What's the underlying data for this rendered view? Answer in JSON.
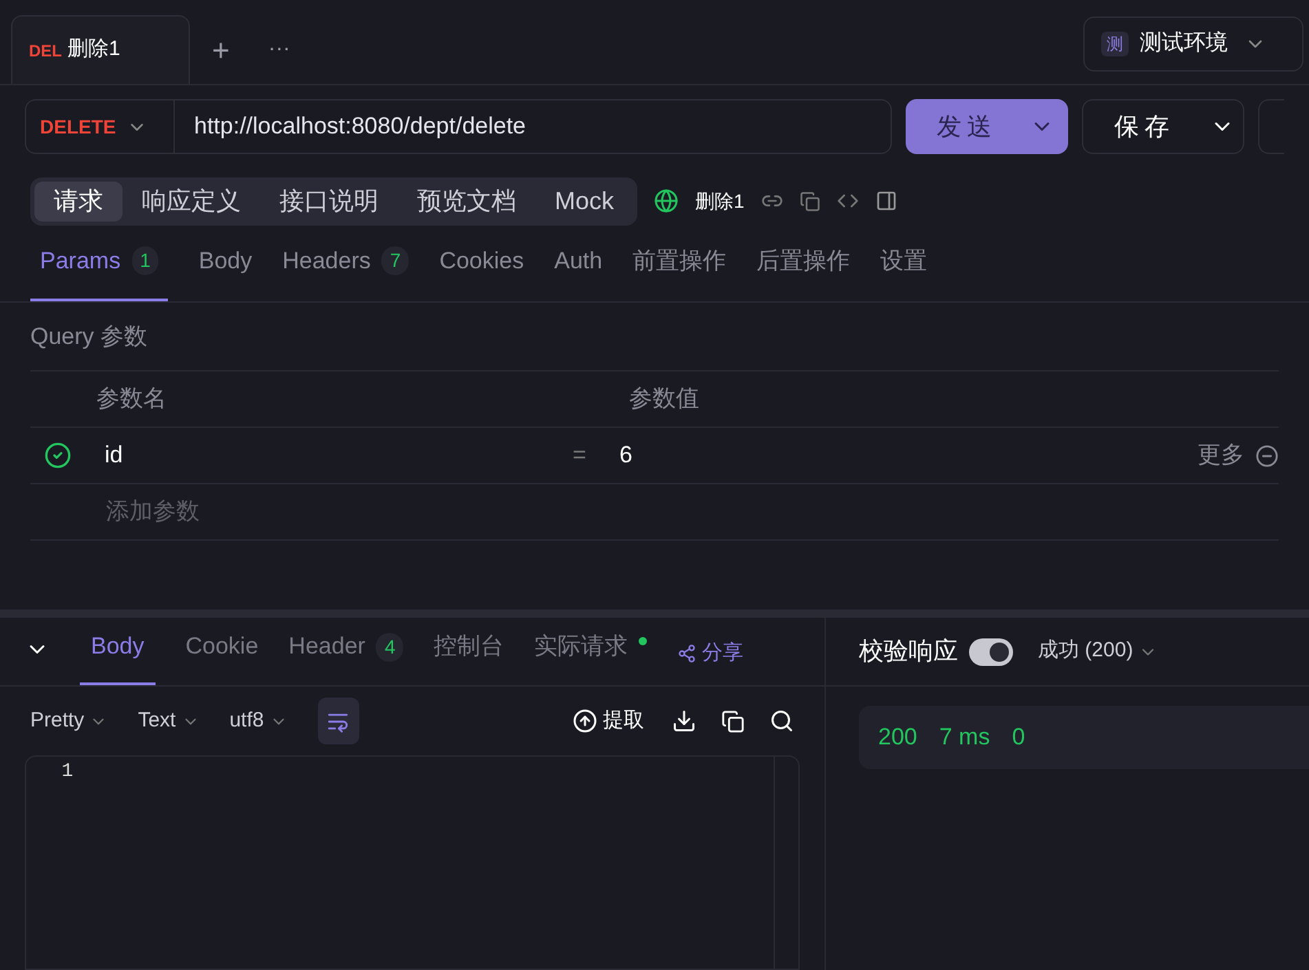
{
  "request_tabs": [
    {
      "method": "DEL",
      "title": "删除1",
      "selected": true
    }
  ],
  "tab_actions": {
    "add": "+",
    "more": "···"
  },
  "environment": {
    "badge": "测",
    "name": "测试环境"
  },
  "url_bar": {
    "method": "DELETE",
    "url": "http://localhost:8080/dept/delete",
    "send": "发送",
    "save": "保存"
  },
  "view_tabs": [
    {
      "label": "请求",
      "selected": true
    },
    {
      "label": "响应定义",
      "selected": false
    },
    {
      "label": "接口说明",
      "selected": false
    },
    {
      "label": "预览文档",
      "selected": false
    },
    {
      "label": "Mock",
      "selected": false
    }
  ],
  "api_name": "删除1",
  "param_tabs": [
    {
      "label": "Params",
      "count": "1",
      "selected": true
    },
    {
      "label": "Body",
      "selected": false
    },
    {
      "label": "Headers",
      "count": "7",
      "selected": false
    },
    {
      "label": "Cookies",
      "selected": false
    },
    {
      "label": "Auth",
      "selected": false
    },
    {
      "label": "前置操作",
      "selected": false
    },
    {
      "label": "后置操作",
      "selected": false
    },
    {
      "label": "设置",
      "selected": false
    }
  ],
  "query": {
    "title": "Query 参数",
    "columns": [
      "参数名",
      "参数值"
    ],
    "rows": [
      {
        "enabled": true,
        "name": "id",
        "operator": "=",
        "value": "6",
        "more": "更多"
      }
    ],
    "add_placeholder": "添加参数"
  },
  "response_tabs": [
    {
      "label": "Body",
      "selected": true
    },
    {
      "label": "Cookie",
      "selected": false
    },
    {
      "label": "Header",
      "count": "4",
      "selected": false
    },
    {
      "label": "控制台",
      "selected": false
    },
    {
      "label": "实际请求",
      "dot": true,
      "selected": false
    }
  ],
  "share": "分享",
  "body_toolbar": {
    "format": "Pretty",
    "type": "Text",
    "encoding": "utf8",
    "extract": "提取"
  },
  "line_numbers": [
    "1"
  ],
  "validate": {
    "label": "校验响应",
    "on": true,
    "status": "成功 (200)"
  },
  "summary": [
    "200",
    "7 ms",
    "0"
  ]
}
